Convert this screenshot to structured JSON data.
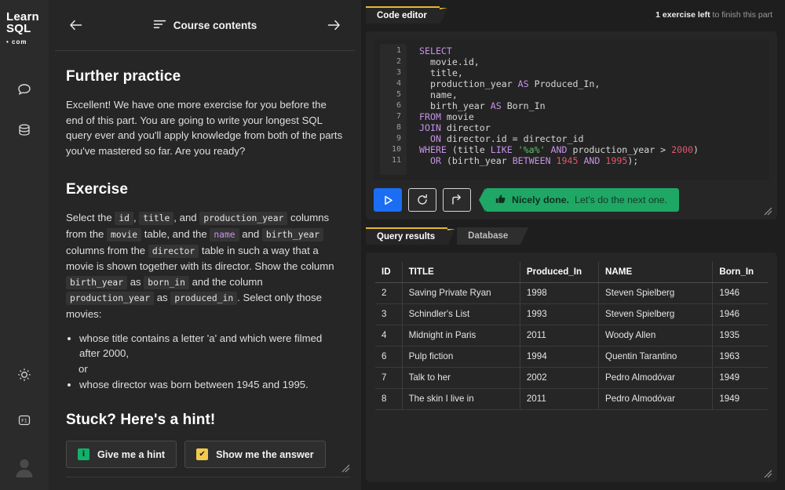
{
  "brand": {
    "line1": "Learn",
    "line2": "SQL",
    "line3": "• com"
  },
  "rail": {
    "icons": [
      {
        "name": "chat-bubble-icon",
        "label": "Discussion"
      },
      {
        "name": "database-icon",
        "label": "Database"
      },
      {
        "name": "brightness-icon",
        "label": "Theme"
      },
      {
        "name": "f1-key-icon",
        "label": "F1"
      },
      {
        "name": "avatar-icon",
        "label": "Account"
      }
    ]
  },
  "lesson": {
    "nav": {
      "back_arrow": "←",
      "forward_arrow": "→",
      "contents_label": "Course contents"
    },
    "heading_practice": "Further practice",
    "intro": "Excellent! We have one more exercise for you before the end of this part. You are going to write your longest SQL query ever and you'll apply knowledge from both of the parts you've mastered so far. Are you ready?",
    "heading_exercise": "Exercise",
    "exercise": {
      "t1": "Select the",
      "c_id": "id",
      "t2": ",",
      "c_title": "title",
      "t3": ", and",
      "c_production_year": "production_year",
      "t4": "columns from the",
      "c_movie": "movie",
      "t5": "table, and the",
      "c_name": "name",
      "t6": "and",
      "c_birth_year": "birth_year",
      "t7": "columns from the",
      "c_director": "director",
      "t8": "table in such a way that a movie is shown together with its director. Show the column",
      "c_birth_year2": "birth_year",
      "t9": "as",
      "c_born_in": "born_in",
      "t10": "and the column",
      "c_production_year2": "production_year",
      "t11": "as",
      "c_produced_in": "produced_in",
      "t12": ". Select only those movies:"
    },
    "bullets": [
      "whose title contains a letter 'a' and which were filmed after 2000,",
      "or",
      "whose director was born between 1945 and 1995."
    ],
    "heading_hint": "Stuck? Here's a hint!",
    "buttons": {
      "hint": {
        "label": "Give me a hint",
        "icon": "i",
        "icon_color": "#13b06a"
      },
      "answer": {
        "label": "Show me the answer",
        "icon": "✔",
        "icon_color": "#f2c94c"
      }
    }
  },
  "editor": {
    "tabs": [
      {
        "label": "Code editor",
        "active": true
      }
    ],
    "status": {
      "bold": "1 exercise left",
      "rest": " to finish this part"
    },
    "accent_color": "#e8b730",
    "line_numbers": [
      "1",
      "2",
      "3",
      "4",
      "5",
      "6",
      "7",
      "8",
      "9",
      "10",
      "11"
    ],
    "code_lines": [
      [
        {
          "t": "SELECT",
          "c": "kw"
        }
      ],
      [
        {
          "t": "  movie.id,",
          "c": "fn"
        }
      ],
      [
        {
          "t": "  title,",
          "c": "fn"
        }
      ],
      [
        {
          "t": "  production_year ",
          "c": "fn"
        },
        {
          "t": "AS",
          "c": "kw"
        },
        {
          "t": " Produced_In,",
          "c": "fn"
        }
      ],
      [
        {
          "t": "  name,",
          "c": "fn"
        }
      ],
      [
        {
          "t": "  birth_year ",
          "c": "fn"
        },
        {
          "t": "AS",
          "c": "kw"
        },
        {
          "t": " Born_In",
          "c": "fn"
        }
      ],
      [
        {
          "t": "FROM",
          "c": "kw"
        },
        {
          "t": " movie",
          "c": "fn"
        }
      ],
      [
        {
          "t": "JOIN",
          "c": "kw"
        },
        {
          "t": " director",
          "c": "fn"
        }
      ],
      [
        {
          "t": "  ",
          "c": "fn"
        },
        {
          "t": "ON",
          "c": "kw"
        },
        {
          "t": " director.id = director_id",
          "c": "fn"
        }
      ],
      [
        {
          "t": "WHERE",
          "c": "kw"
        },
        {
          "t": " (title ",
          "c": "fn"
        },
        {
          "t": "LIKE",
          "c": "kw"
        },
        {
          "t": " ",
          "c": "fn"
        },
        {
          "t": "'%a%'",
          "c": "str"
        },
        {
          "t": " ",
          "c": "fn"
        },
        {
          "t": "AND",
          "c": "kw"
        },
        {
          "t": " production_year > ",
          "c": "fn"
        },
        {
          "t": "2000",
          "c": "num"
        },
        {
          "t": ")",
          "c": "fn"
        }
      ],
      [
        {
          "t": "  ",
          "c": "fn"
        },
        {
          "t": "OR",
          "c": "kw"
        },
        {
          "t": " (birth_year ",
          "c": "fn"
        },
        {
          "t": "BETWEEN",
          "c": "kw"
        },
        {
          "t": " ",
          "c": "fn"
        },
        {
          "t": "1945",
          "c": "num"
        },
        {
          "t": " ",
          "c": "fn"
        },
        {
          "t": "AND",
          "c": "kw"
        },
        {
          "t": " ",
          "c": "fn"
        },
        {
          "t": "1995",
          "c": "num"
        },
        {
          "t": ");",
          "c": "fn"
        }
      ]
    ],
    "toolbar": {
      "run_button": "run-query",
      "reset_button": "reset-code",
      "next_button": "next-exercise",
      "run_color": "#1b6ef3"
    },
    "feedback": {
      "icon": "thumbs-up",
      "bold": "Nicely done.",
      "rest": " Let's do the next one.",
      "color": "#1fa765"
    }
  },
  "results": {
    "tabs": [
      {
        "label": "Query results",
        "active": true
      },
      {
        "label": "Database",
        "active": false
      }
    ],
    "columns": [
      "ID",
      "TITLE",
      "Produced_In",
      "NAME",
      "Born_In"
    ],
    "rows": [
      [
        "2",
        "Saving Private Ryan",
        "1998",
        "Steven Spielberg",
        "1946"
      ],
      [
        "3",
        "Schindler's List",
        "1993",
        "Steven Spielberg",
        "1946"
      ],
      [
        "4",
        "Midnight in Paris",
        "2011",
        "Woody Allen",
        "1935"
      ],
      [
        "6",
        "Pulp fiction",
        "1994",
        "Quentin Tarantino",
        "1963"
      ],
      [
        "7",
        "Talk to her",
        "2002",
        "Pedro Almodóvar",
        "1949"
      ],
      [
        "8",
        "The skin I live in",
        "2011",
        "Pedro Almodóvar",
        "1949"
      ]
    ]
  }
}
